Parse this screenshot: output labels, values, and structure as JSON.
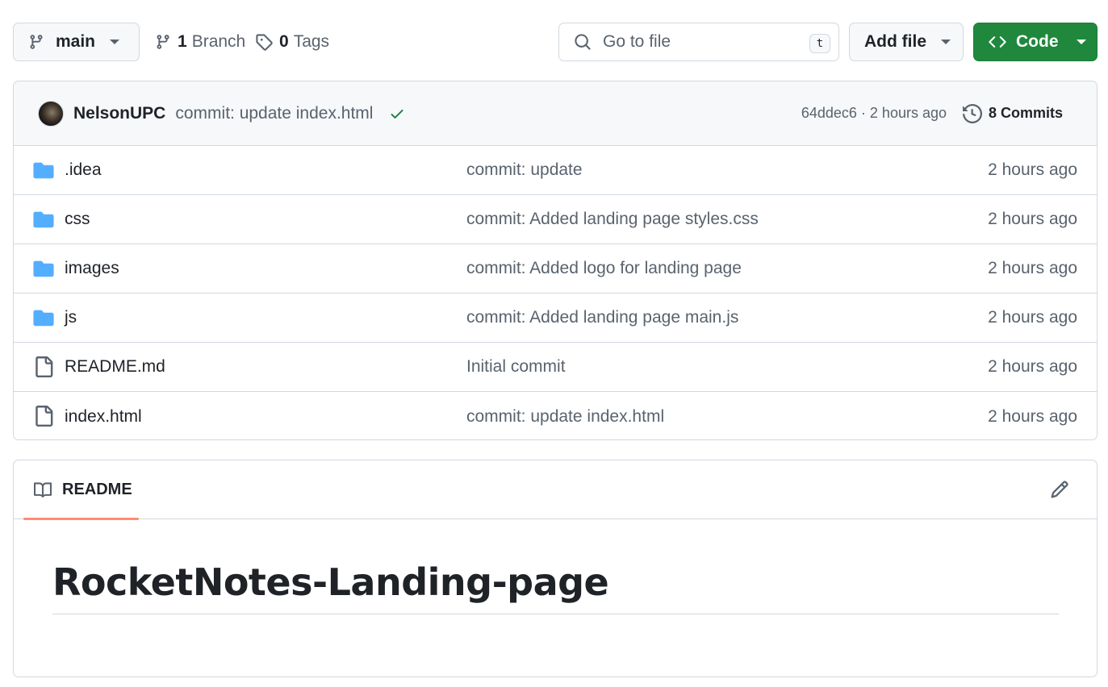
{
  "toolbar": {
    "branch_label": "main",
    "branch_count": "1",
    "branch_word": "Branch",
    "tag_count": "0",
    "tag_word": "Tags",
    "search_placeholder": "Go to file",
    "search_shortcut": "t",
    "add_file_label": "Add file",
    "code_label": "Code",
    "code_color": "#1f883d"
  },
  "commit": {
    "author": "NelsonUPC",
    "message": "commit: update index.html",
    "sha_time": "64ddec6 · 2 hours ago",
    "commits_label": "8 Commits",
    "status_icon": "check-icon"
  },
  "files": [
    {
      "name": ".idea",
      "type": "folder",
      "message": "commit: update",
      "age": "2 hours ago"
    },
    {
      "name": "css",
      "type": "folder",
      "message": "commit: Added landing page styles.css",
      "age": "2 hours ago"
    },
    {
      "name": "images",
      "type": "folder",
      "message": "commit: Added logo for landing page",
      "age": "2 hours ago"
    },
    {
      "name": "js",
      "type": "folder",
      "message": "commit: Added landing page main.js",
      "age": "2 hours ago"
    },
    {
      "name": "README.md",
      "type": "file",
      "message": "Initial commit",
      "age": "2 hours ago"
    },
    {
      "name": "index.html",
      "type": "file",
      "message": "commit: update index.html",
      "age": "2 hours ago"
    }
  ],
  "readme": {
    "tab_label": "README",
    "heading": "RocketNotes-Landing-page",
    "tab_accent": "#fd8c73"
  },
  "colors": {
    "folder": "#54aeff",
    "success": "#1a7f37"
  }
}
